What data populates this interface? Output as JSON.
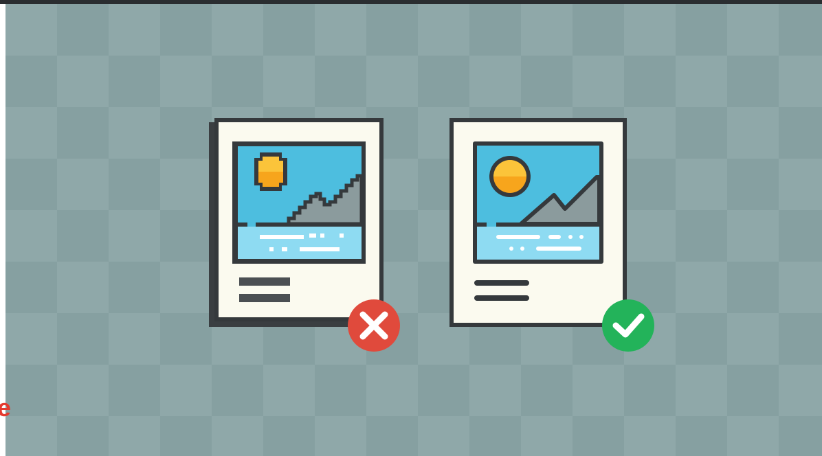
{
  "scene": {
    "background_colors": [
      "#8fa8a9",
      "#86a0a1"
    ],
    "cards": [
      {
        "name": "pixelated-card",
        "status_icon": "close-icon",
        "status_color": "#e04a3c"
      },
      {
        "name": "smooth-card",
        "status_icon": "check-icon",
        "status_color": "#23b35a"
      }
    ],
    "palette": {
      "card": "#fbfaef",
      "outline": "#35393c",
      "sky": "#4dbedf",
      "water": "#8edbf2",
      "sun": "#f7a51c",
      "mountain": "#8b9b9d"
    }
  },
  "edge_fragment": "e"
}
